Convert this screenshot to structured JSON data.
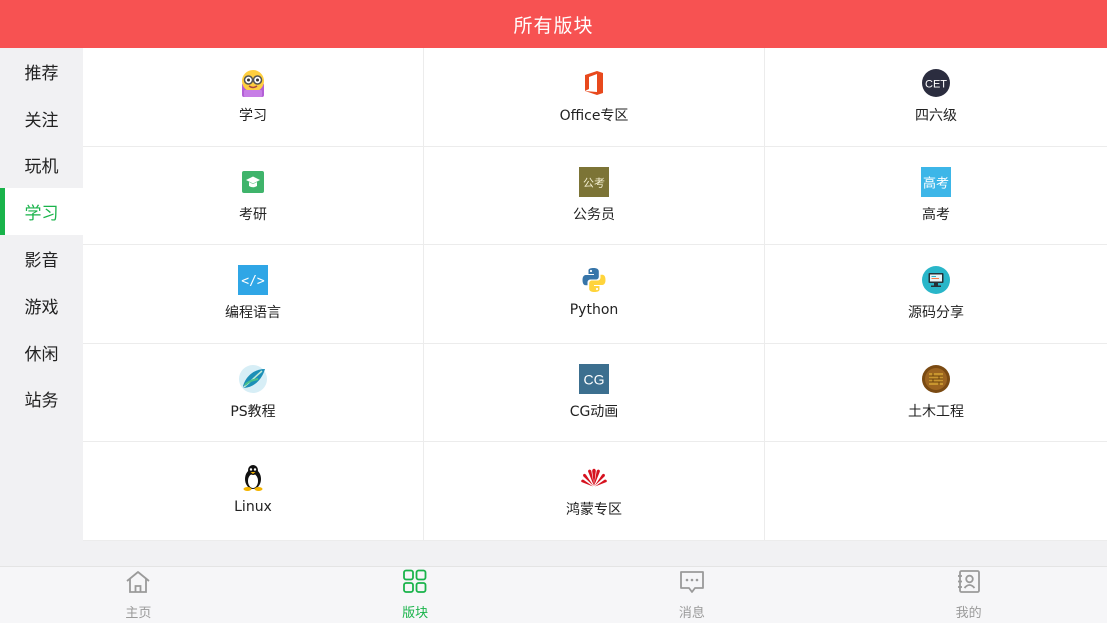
{
  "header": {
    "title": "所有版块"
  },
  "sidebar": {
    "items": [
      {
        "label": "推荐",
        "active": false
      },
      {
        "label": "关注",
        "active": false
      },
      {
        "label": "玩机",
        "active": false
      },
      {
        "label": "学习",
        "active": true
      },
      {
        "label": "影音",
        "active": false
      },
      {
        "label": "游戏",
        "active": false
      },
      {
        "label": "休闲",
        "active": false
      },
      {
        "label": "站务",
        "active": false
      }
    ],
    "accent_color": "#19b34a"
  },
  "grid": {
    "items": [
      {
        "label": "学习",
        "icon": "nerd-face-icon"
      },
      {
        "label": "Office专区",
        "icon": "office-logo-icon"
      },
      {
        "label": "四六级",
        "icon": "cet-badge-icon",
        "icon_text": "CET"
      },
      {
        "label": "考研",
        "icon": "graduation-cap-icon"
      },
      {
        "label": "公务员",
        "icon": "civil-exam-icon",
        "icon_text": "公考"
      },
      {
        "label": "高考",
        "icon": "gaokao-icon",
        "icon_text": "高考"
      },
      {
        "label": "编程语言",
        "icon": "code-brackets-icon",
        "icon_text": "</>"
      },
      {
        "label": "Python",
        "icon": "python-logo-icon"
      },
      {
        "label": "源码分享",
        "icon": "monitor-code-icon"
      },
      {
        "label": "PS教程",
        "icon": "ps-feather-icon"
      },
      {
        "label": "CG动画",
        "icon": "cg-badge-icon",
        "icon_text": "CG"
      },
      {
        "label": "土木工程",
        "icon": "brick-wall-icon"
      },
      {
        "label": "Linux",
        "icon": "tux-penguin-icon"
      },
      {
        "label": "鸿蒙专区",
        "icon": "huawei-logo-icon"
      }
    ]
  },
  "tabbar": {
    "items": [
      {
        "label": "主页",
        "icon": "home-icon",
        "active": false
      },
      {
        "label": "版块",
        "icon": "grid-icon",
        "active": true
      },
      {
        "label": "消息",
        "icon": "message-icon",
        "active": false
      },
      {
        "label": "我的",
        "icon": "contacts-icon",
        "active": false
      }
    ]
  },
  "colors": {
    "header_bg": "#f75252",
    "accent": "#19b34a",
    "inactive": "#9a9a9a"
  }
}
